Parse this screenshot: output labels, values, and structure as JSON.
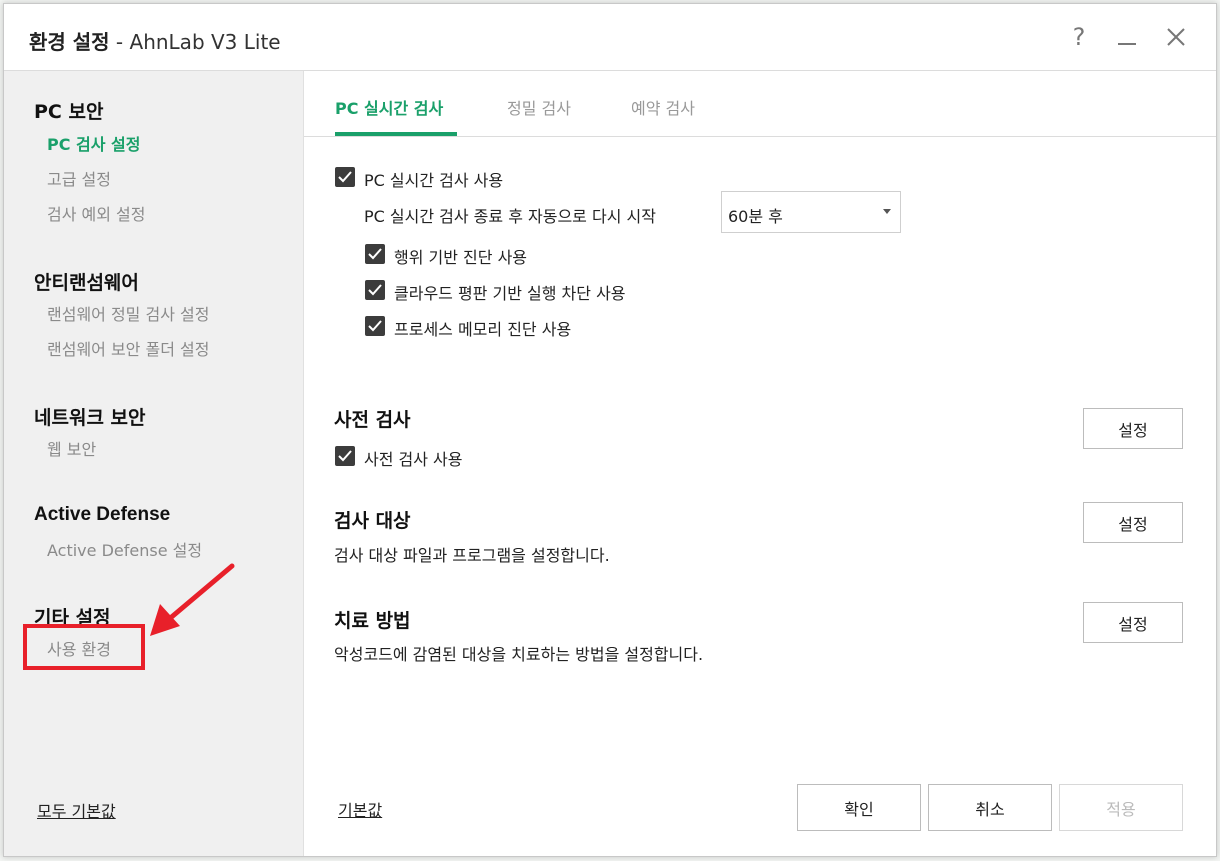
{
  "window": {
    "title_bold": "환경 설정",
    "title_rest": " - AhnLab V3 Lite",
    "help": "?",
    "minimize": "_",
    "close": "✕"
  },
  "sidebar": {
    "sections": [
      {
        "title": "PC 보안",
        "items": [
          "PC 검사 설정",
          "고급 설정",
          "검사 예외 설정"
        ]
      },
      {
        "title": "안티랜섬웨어",
        "items": [
          "랜섬웨어 정밀 검사 설정",
          "랜섬웨어 보안 폴더 설정"
        ]
      },
      {
        "title": "네트워크 보안",
        "items": [
          "웹 보안"
        ]
      },
      {
        "title": "Active Defense",
        "items": [
          "Active Defense 설정"
        ]
      },
      {
        "title": "기타 설정",
        "items": [
          "사용 환경"
        ]
      }
    ],
    "reset_all": "모두 기본값"
  },
  "tabs": [
    "PC 실시간 검사",
    "정밀 검사",
    "예약 검사"
  ],
  "realtime": {
    "enable_label": "PC 실시간 검사 사용",
    "restart_label": "PC 실시간 검사 종료 후 자동으로 다시 시작",
    "restart_value": "60분 후",
    "options": [
      "행위 기반 진단 사용",
      "클라우드 평판 기반 실행 차단 사용",
      "프로세스 메모리 진단 사용"
    ]
  },
  "precheck": {
    "title": "사전 검사",
    "enable_label": "사전 검사 사용",
    "button": "설정"
  },
  "target": {
    "title": "검사 대상",
    "desc": "검사 대상 파일과 프로그램을 설정합니다.",
    "button": "설정"
  },
  "treatment": {
    "title": "치료 방법",
    "desc": "악성코드에 감염된 대상을 치료하는 방법을 설정합니다.",
    "button": "설정"
  },
  "footer": {
    "default": "기본값",
    "ok": "확인",
    "cancel": "취소",
    "apply": "적용"
  },
  "colors": {
    "accent": "#1aa06a",
    "annotation": "#e8202a"
  }
}
